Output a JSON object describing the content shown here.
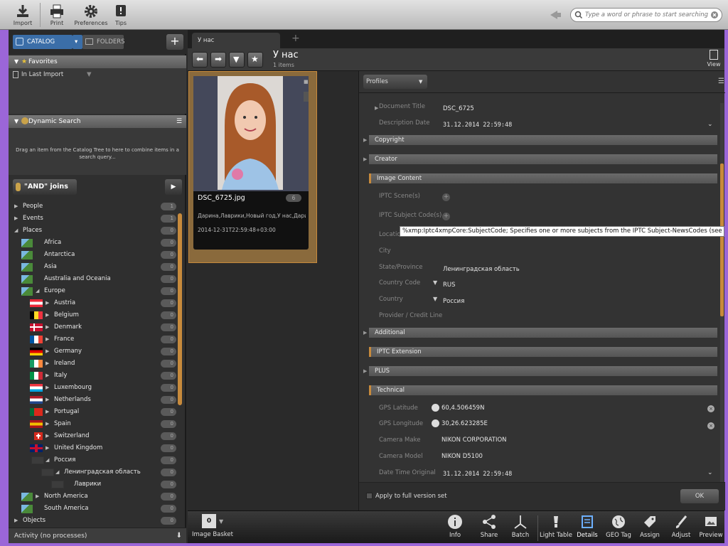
{
  "toolbar": {
    "import": "Import",
    "print": "Print",
    "preferences": "Preferences",
    "tips": "Tips",
    "search_placeholder": "Type a word or phrase to start searching"
  },
  "catalog": {
    "catalog_label": "CATALOG",
    "folders_label": "FOLDERS",
    "favorites_header": "Favorites",
    "in_last_import": "In Last Import",
    "dynamic_search_header": "Dynamic Search",
    "drag_hint": "Drag an item from the Catalog Tree to here to combine items in a search query...",
    "and_joins": "\"AND\" joins"
  },
  "tree": [
    {
      "label": "People",
      "count": "1"
    },
    {
      "label": "Events",
      "count": "1"
    },
    {
      "label": "Places",
      "count": "0"
    },
    {
      "label": "Africa",
      "count": "0"
    },
    {
      "label": "Antarctica",
      "count": "0"
    },
    {
      "label": "Asia",
      "count": "0"
    },
    {
      "label": "Australia and Oceania",
      "count": "0"
    },
    {
      "label": "Europe",
      "count": "0"
    },
    {
      "label": "Austria",
      "count": "0"
    },
    {
      "label": "Belgium",
      "count": "0"
    },
    {
      "label": "Denmark",
      "count": "0"
    },
    {
      "label": "France",
      "count": "0"
    },
    {
      "label": "Germany",
      "count": "0"
    },
    {
      "label": "Ireland",
      "count": "0"
    },
    {
      "label": "Italy",
      "count": "0"
    },
    {
      "label": "Luxembourg",
      "count": "0"
    },
    {
      "label": "Netherlands",
      "count": "0"
    },
    {
      "label": "Portugal",
      "count": "0"
    },
    {
      "label": "Spain",
      "count": "0"
    },
    {
      "label": "Switzerland",
      "count": "0"
    },
    {
      "label": "United Kingdom",
      "count": "0"
    },
    {
      "label": "Россия",
      "count": "0"
    },
    {
      "label": "Ленинградская область",
      "count": "0"
    },
    {
      "label": "Лаврики",
      "count": "0"
    },
    {
      "label": "North America",
      "count": "0"
    },
    {
      "label": "South America",
      "count": "0"
    },
    {
      "label": "Objects",
      "count": "0"
    }
  ],
  "activity": "Activity (no processes)",
  "tab": {
    "name": "У нас",
    "title": "У нас",
    "subtitle": "1 items",
    "view": "View"
  },
  "thumb": {
    "filename": "DSC_6725.jpg",
    "rating": "6",
    "keywords": "Дарина,Лаврики,Новый год,У нас,Дари",
    "datetime": "2014-12-31T22:59:48+03:00"
  },
  "profiles": "Profiles",
  "meta": {
    "document_title_lbl": "Document Title",
    "document_title_val": "DSC_6725",
    "description_date_lbl": "Description Date",
    "description_date_val": "31.12.2014  22:59:48",
    "copyright": "Copyright",
    "creator": "Creator",
    "image_content": "Image Content",
    "iptc_scene_lbl": "IPTC Scene(s)",
    "iptc_subject_lbl": "IPTC Subject Code(s)",
    "location_lbl": "Location",
    "city_lbl": "City",
    "state_lbl": "State/Province",
    "state_val": "Ленинградская область",
    "country_code_lbl": "Country Code",
    "country_code_val": "RUS",
    "country_lbl": "Country",
    "country_val": "Россия",
    "provider_lbl": "Provider / Credit Line",
    "additional": "Additional",
    "iptc_extension": "IPTC Extension",
    "plus": "PLUS",
    "technical": "Technical",
    "gps_lat_lbl": "GPS Latitude",
    "gps_lat_val": "60,4.506459N",
    "gps_lon_lbl": "GPS Longitude",
    "gps_lon_val": "30,26.623285E",
    "camera_make_lbl": "Camera Make",
    "camera_make_val": "NIKON CORPORATION",
    "camera_model_lbl": "Camera Model",
    "camera_model_val": "NIKON D5100",
    "dto_lbl": "Date Time Original",
    "dto_val": "31.12.2014  22:59:48",
    "apply_full": "Apply to full version set",
    "ok": "OK"
  },
  "tooltip": "%xmp:Iptc4xmpCore:SubjectCode; Specifies one or more subjects from the IPTC Subject-NewsCodes (see www.newscodes.org)",
  "bottom": {
    "image_basket": "Image Basket",
    "basket_count": "0",
    "info": "Info",
    "share": "Share",
    "batch": "Batch",
    "light_table": "Light Table",
    "details": "Details",
    "geo_tag": "GEO Tag",
    "assign": "Assign",
    "adjust": "Adjust",
    "preview": "Preview"
  },
  "colors": {
    "accent": "#c78a3c",
    "frame": "#9b66d8",
    "catalog_blue": "#3b6ea8"
  }
}
